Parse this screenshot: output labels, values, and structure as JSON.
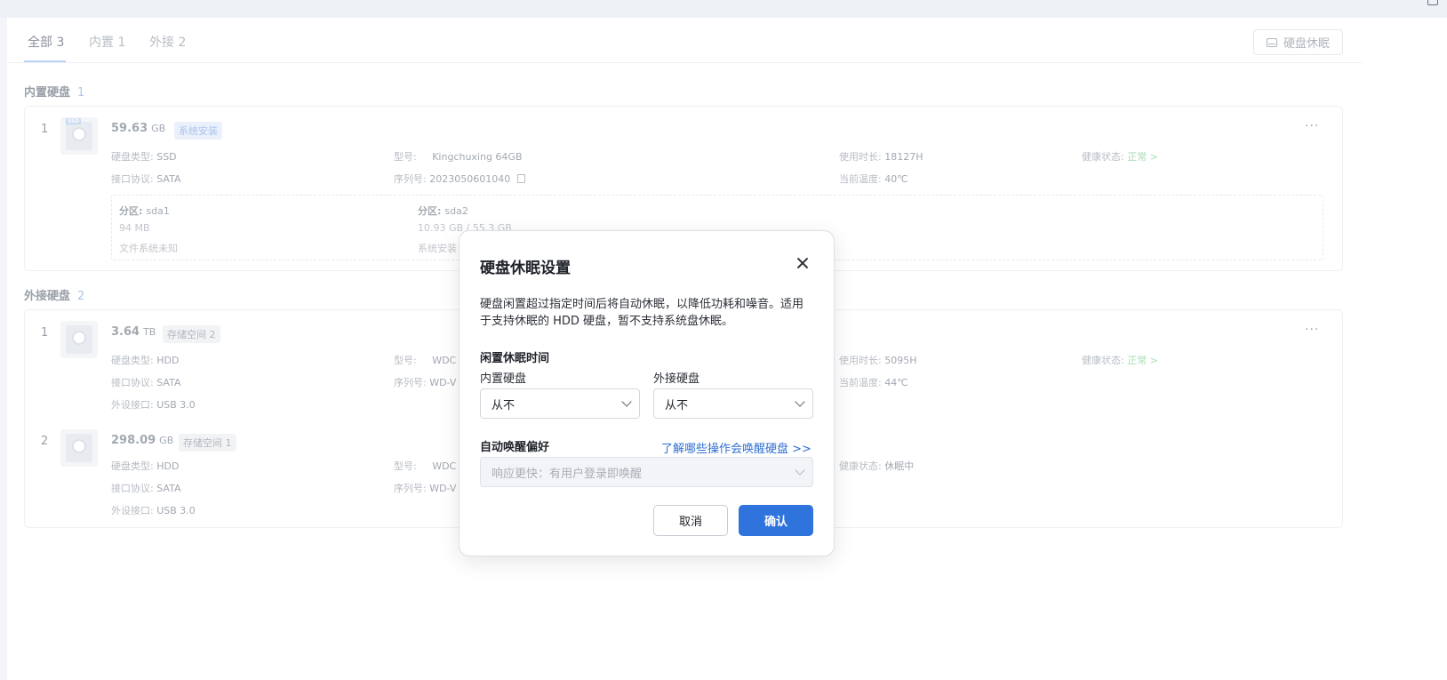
{
  "tabs": [
    {
      "label": "全部 3"
    },
    {
      "label": "内置 1"
    },
    {
      "label": "外接 2"
    }
  ],
  "toolbar": {
    "sleep_button": "硬盘休眠"
  },
  "internal_section": {
    "title": "内置硬盘",
    "count": "1"
  },
  "external_section": {
    "title": "外接硬盘",
    "count": "2"
  },
  "labels": {
    "type": "硬盘类型:",
    "model": "型号:",
    "uptime": "使用时长:",
    "health": "健康状态:",
    "protocol": "接口协议:",
    "serial": "序列号:",
    "temp": "当前温度:",
    "port": "外设接口:",
    "partition": "分区:"
  },
  "disks": [
    {
      "index": "1",
      "capacity": "59.63",
      "unit": "GB",
      "badge": "系统安装",
      "type": "SSD",
      "model": "Kingchuxing 64GB",
      "uptime": "18127H",
      "health": "正常 >",
      "protocol": "SATA",
      "serial": "2023050601040",
      "temp": "40℃",
      "partitions": [
        {
          "name": "sda1",
          "size": "94 MB",
          "fs": "文件系统未知"
        },
        {
          "name": "sda2",
          "size": "10.93 GB / 55.3 GB",
          "fs": "系统安装"
        }
      ]
    },
    {
      "index": "1",
      "capacity": "3.64",
      "unit": "TB",
      "badge": "存储空间 2",
      "type": "HDD",
      "model": "WDC",
      "uptime": "5095H",
      "health": "正常 >",
      "protocol": "SATA",
      "serial": "WD-V",
      "temp": "44℃",
      "port": "USB 3.0"
    },
    {
      "index": "2",
      "capacity": "298.09",
      "unit": "GB",
      "badge": "存储空间 1",
      "type": "HDD",
      "model": "WDC",
      "health": "休眠中",
      "protocol": "SATA",
      "serial": "WD-V",
      "port": "USB 3.0"
    }
  ],
  "modal": {
    "title": "硬盘休眠设置",
    "description": "硬盘闲置超过指定时间后将自动休眠，以降低功耗和噪音。适用于支持休眠的 HDD 硬盘，暂不支持系统盘休眠。",
    "idle_section": "闲置休眠时间",
    "internal_label": "内置硬盘",
    "internal_value": "从不",
    "external_label": "外接硬盘",
    "external_value": "从不",
    "wake_section": "自动唤醒偏好",
    "wake_link": "了解哪些操作会唤醒硬盘 >>",
    "wake_value": "响应更快：有用户登录即唤醒",
    "cancel": "取消",
    "confirm": "确认"
  }
}
